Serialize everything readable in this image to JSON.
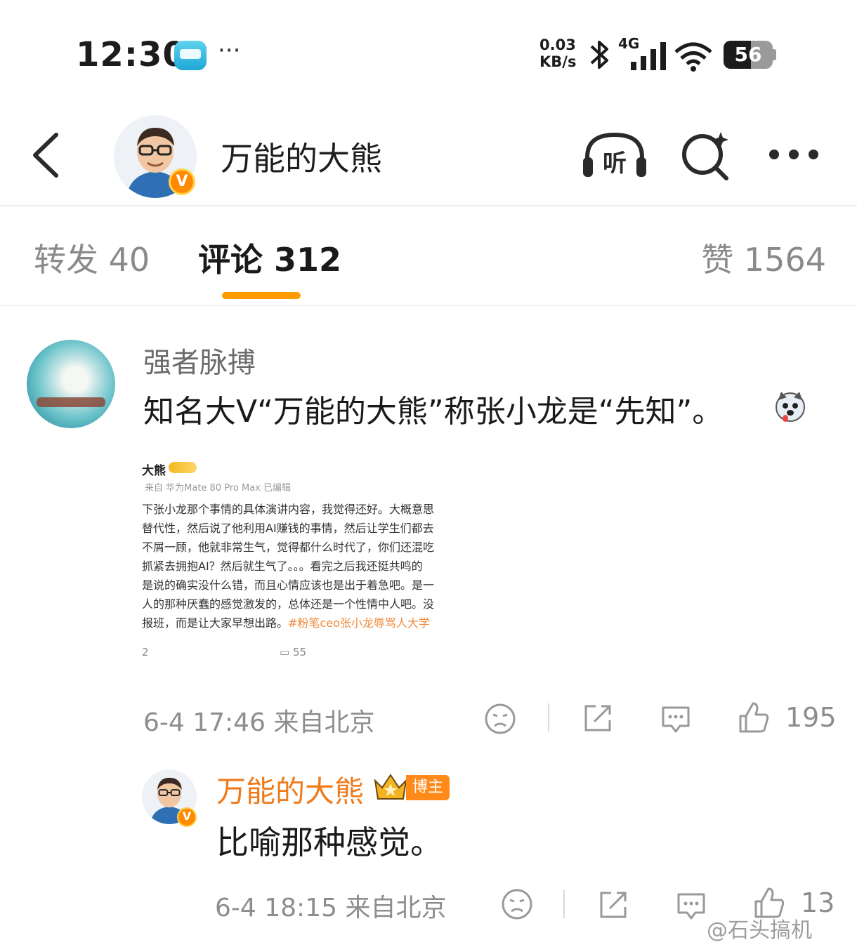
{
  "status_bar": {
    "time": "12:30",
    "more": "···",
    "speed_value": "0.03",
    "speed_unit": "KB/s",
    "network": "4G",
    "battery": "56",
    "icons": [
      "app-icon",
      "bluetooth-icon",
      "signal-icon",
      "wifi-icon",
      "battery-icon"
    ]
  },
  "header": {
    "title": "万能的大熊",
    "verified_mark": "V",
    "listen_label": "听",
    "icons": [
      "back-icon",
      "listen-icon",
      "search-icon",
      "more-icon"
    ]
  },
  "tabs": {
    "repost": "转发 40",
    "comment": "评论 312",
    "like": "赞 1564",
    "active": "comment",
    "accent_color": "#ff9a00"
  },
  "comment": {
    "username": "强者脉搏",
    "text": "知名大V“万能的大熊”称张小龙是“先知”。",
    "emoji": "husky-emoji",
    "embed": {
      "name": "大熊",
      "source": "来自 华为Mate 80 Pro Max 已编辑",
      "lines": [
        "下张小龙那个事情的具体演讲内容，我觉得还好。大概意思",
        "替代性，然后说了他利用AI赚钱的事情，然后让学生们都去",
        "不屑一顾，他就非常生气，觉得都什么时代了，你们还混吃",
        "抓紧去拥抱AI？然后就生气了。。。看完之后我还挺共鸣的",
        "是说的确实没什么错，而且心情应该也是出于着急吧。是一",
        "人的那种厌蠢的感觉激发的，总体还是一个性情中人吧。没",
        "报班，而是让大家早想出路。"
      ],
      "hashtag": "#粉笔ceo张小龙辱骂人大学",
      "footer_left": "2",
      "footer_comments": "55"
    },
    "time": "6-4 17:46",
    "location": "来自北京",
    "likes": "195"
  },
  "reply": {
    "username": "万能的大熊",
    "role_badge": "博主",
    "text": "比喻那种感觉。",
    "time": "6-4 18:15",
    "location": "来自北京",
    "likes": "13",
    "name_color": "#f07a1a"
  },
  "watermark": "@石头搞机"
}
